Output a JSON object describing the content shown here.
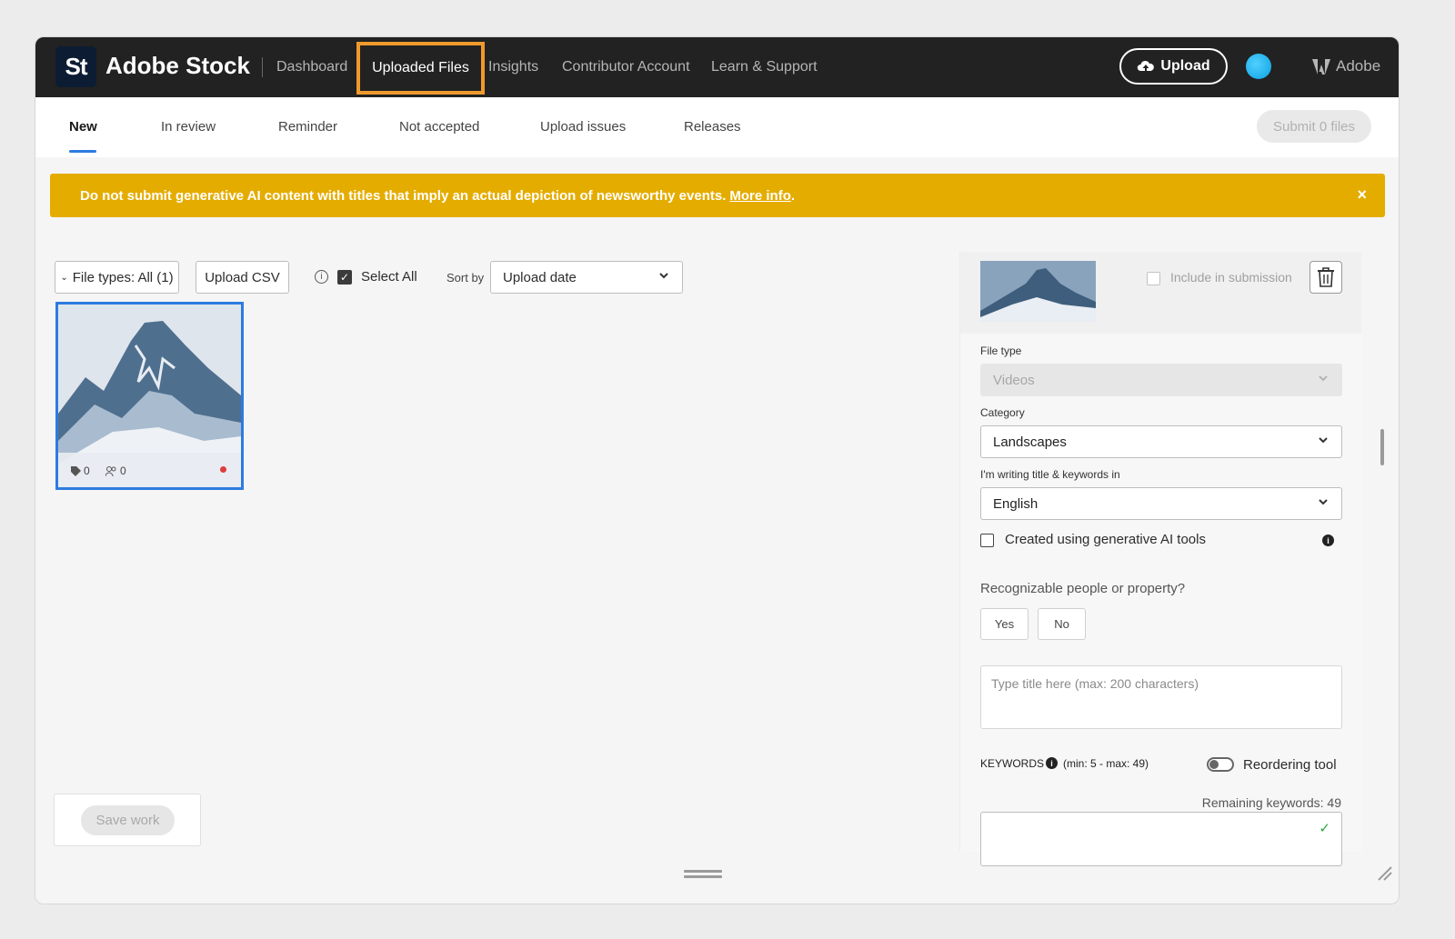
{
  "topbar": {
    "logo_text": "St",
    "brand": "Adobe Stock",
    "nav": [
      "Dashboard",
      "Uploaded Files",
      "Insights",
      "Contributor Account",
      "Learn & Support"
    ],
    "active_nav": "Uploaded Files",
    "upload_label": "Upload",
    "adobe_label": "Adobe"
  },
  "subnav": {
    "tabs": [
      "New",
      "In review",
      "Reminder",
      "Not accepted",
      "Upload issues",
      "Releases"
    ],
    "active_tab": "New",
    "submit_label": "Submit 0 files"
  },
  "banner": {
    "text": "Do not submit generative AI content with titles that imply an actual depiction of newsworthy events.",
    "link": "More info",
    "close": "×"
  },
  "toolbar": {
    "file_types": "File types: All (1)",
    "upload_csv": "Upload CSV",
    "info_glyph": "i",
    "select_all": "Select All",
    "sort_by_label": "Sort by",
    "sort_value": "Upload date"
  },
  "thumbnail": {
    "keywords_count": "0",
    "people_count": "0"
  },
  "save_work": "Save work",
  "panel": {
    "include_label": "Include in submission",
    "file_type_label": "File type",
    "file_type_value": "Videos",
    "category_label": "Category",
    "category_value": "Landscapes",
    "language_label": "I'm writing title & keywords in",
    "language_value": "English",
    "gen_ai_label": "Created using generative AI tools",
    "recognizable_label": "Recognizable people or property?",
    "yes": "Yes",
    "no": "No",
    "title_placeholder": "Type title here (max: 200 characters)",
    "keywords_label": "KEYWORDS",
    "keywords_range": "(min: 5 - max: 49)",
    "reorder_label": "Reordering tool",
    "remaining_keywords": "Remaining keywords: 49"
  },
  "colors": {
    "topbar": "#222222",
    "accent_blue": "#2d7be0",
    "banner": "#e5ac00",
    "highlight": "#f09a2e"
  }
}
